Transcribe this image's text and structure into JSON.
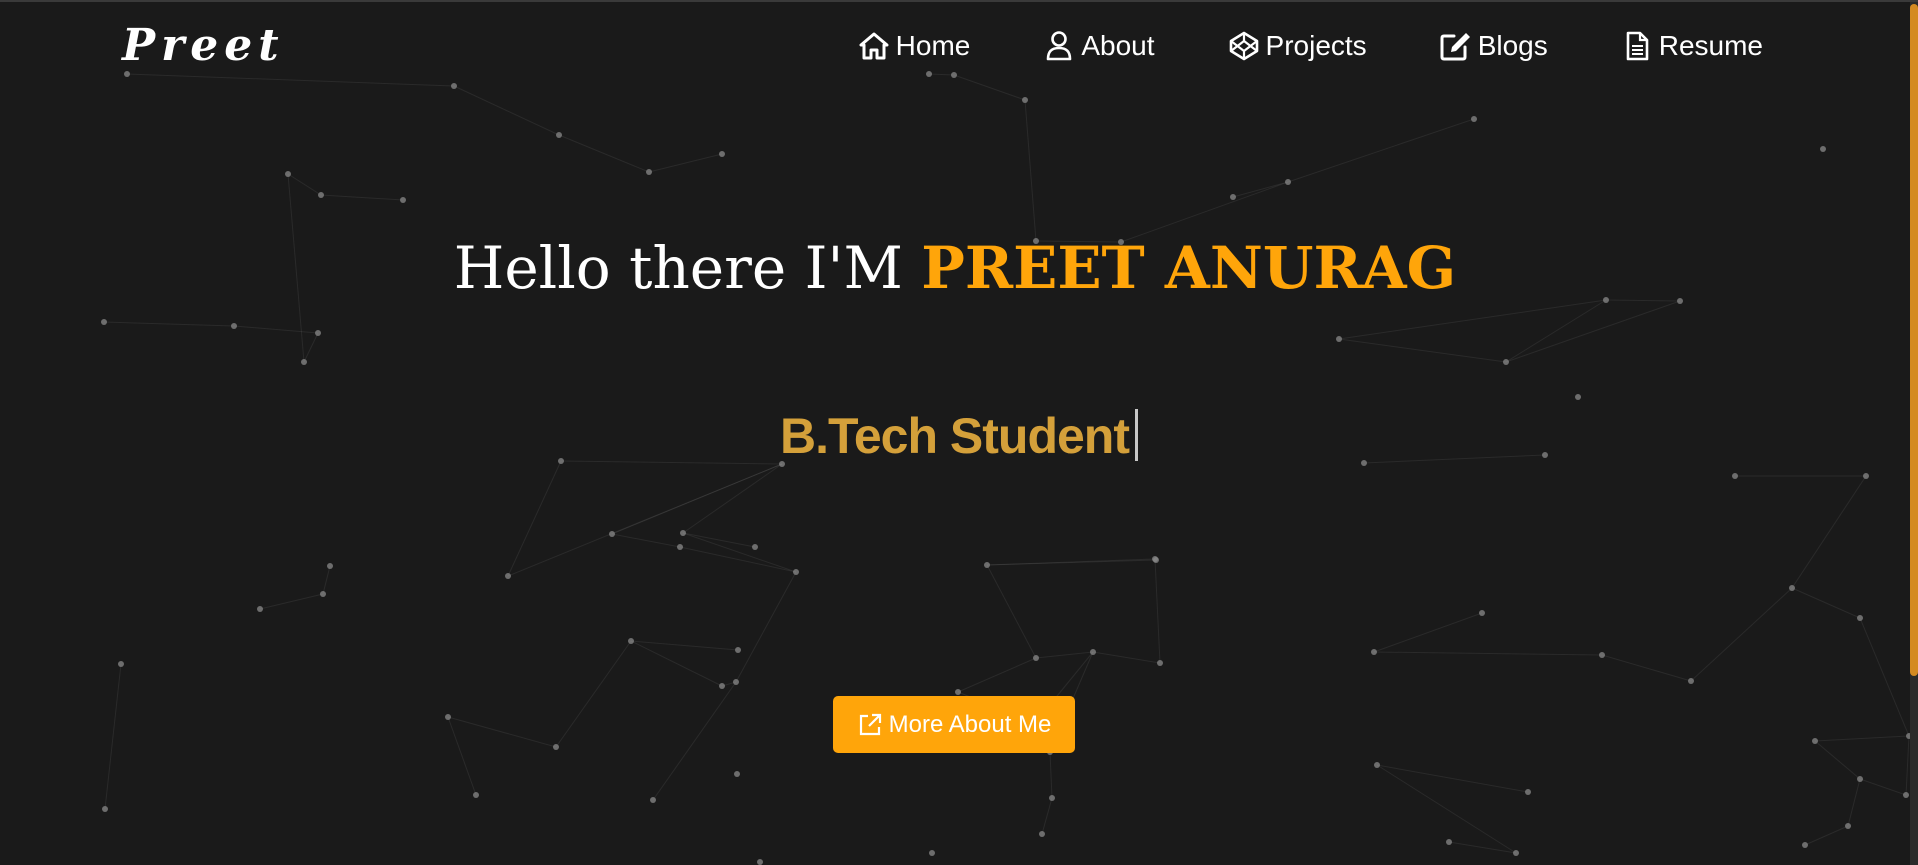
{
  "brand": {
    "logo": "Preet"
  },
  "nav": {
    "items": [
      {
        "label": "Home",
        "icon": "home-icon"
      },
      {
        "label": "About",
        "icon": "user-icon"
      },
      {
        "label": "Projects",
        "icon": "codepen-icon"
      },
      {
        "label": "Blogs",
        "icon": "edit-icon"
      },
      {
        "label": "Resume",
        "icon": "document-icon"
      }
    ]
  },
  "hero": {
    "greeting": "Hello there I'M ",
    "name": "PREET ANURAG",
    "typed_text": "B.Tech Student",
    "cta_label": "More About Me",
    "cta_icon": "external-link-icon"
  },
  "colors": {
    "background": "#1a1a1a",
    "accent": "#ffa50a",
    "typed_text": "#d4a03a",
    "scrollbar_thumb": "#d48a22"
  }
}
